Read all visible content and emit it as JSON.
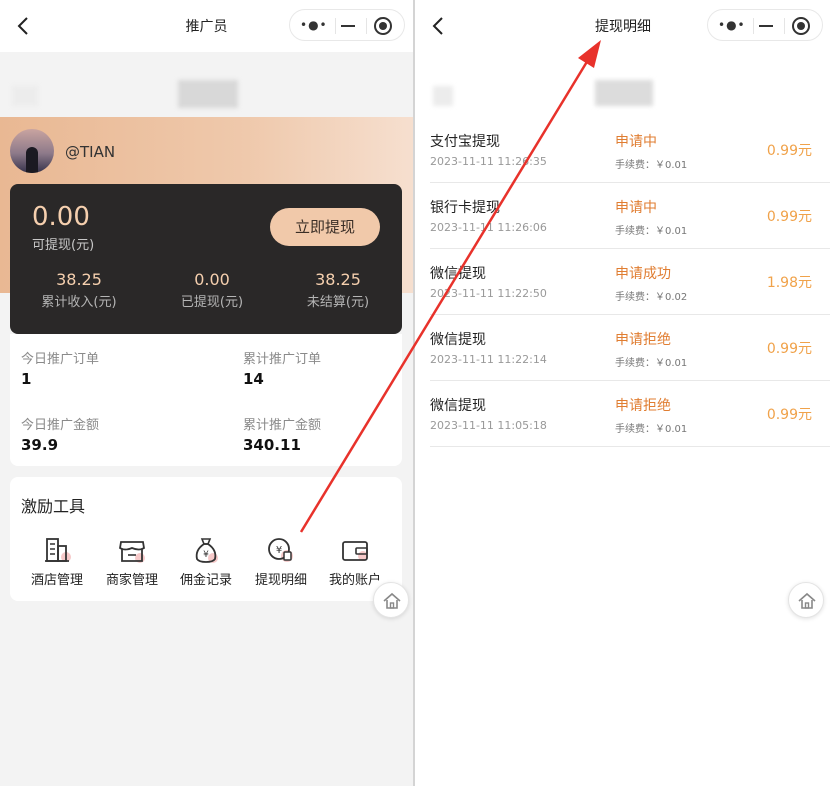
{
  "left": {
    "nav_title": "推广员",
    "username": "@TIAN",
    "balance": {
      "amount": "0.00",
      "label": "可提现(元)",
      "button": "立即提现"
    },
    "stats": [
      {
        "value": "38.25",
        "label": "累计收入(元)"
      },
      {
        "value": "0.00",
        "label": "已提现(元)"
      },
      {
        "value": "38.25",
        "label": "未结算(元)"
      }
    ],
    "metrics": [
      {
        "label": "今日推广订单",
        "value": "1"
      },
      {
        "label": "累计推广订单",
        "value": "14"
      },
      {
        "label": "今日推广金额",
        "value": "39.9"
      },
      {
        "label": "累计推广金额",
        "value": "340.11"
      }
    ],
    "tools_title": "激励工具",
    "tools": [
      {
        "label": "酒店管理",
        "icon": "building-icon"
      },
      {
        "label": "商家管理",
        "icon": "store-icon"
      },
      {
        "label": "佣金记录",
        "icon": "money-bag-icon"
      },
      {
        "label": "提现明细",
        "icon": "yen-coin-icon"
      },
      {
        "label": "我的账户",
        "icon": "wallet-icon"
      }
    ]
  },
  "right": {
    "nav_title": "提现明细",
    "records": [
      {
        "type": "支付宝提现",
        "time": "2023-11-11 11:26:35",
        "status": "申请中",
        "fee": "手续费：￥0.01",
        "amount": "0.99元"
      },
      {
        "type": "银行卡提现",
        "time": "2023-11-11 11:26:06",
        "status": "申请中",
        "fee": "手续费：￥0.01",
        "amount": "0.99元"
      },
      {
        "type": "微信提现",
        "time": "2023-11-11 11:22:50",
        "status": "申请成功",
        "fee": "手续费：￥0.02",
        "amount": "1.98元"
      },
      {
        "type": "微信提现",
        "time": "2023-11-11 11:22:14",
        "status": "申请拒绝",
        "fee": "手续费：￥0.01",
        "amount": "0.99元"
      },
      {
        "type": "微信提现",
        "time": "2023-11-11 11:05:18",
        "status": "申请拒绝",
        "fee": "手续费：￥0.01",
        "amount": "0.99元"
      }
    ]
  },
  "colors": {
    "accent": "#e07d31",
    "amount": "#f0a24a",
    "gold": "#f5cfae",
    "annotation_arrow": "#e8322b"
  }
}
